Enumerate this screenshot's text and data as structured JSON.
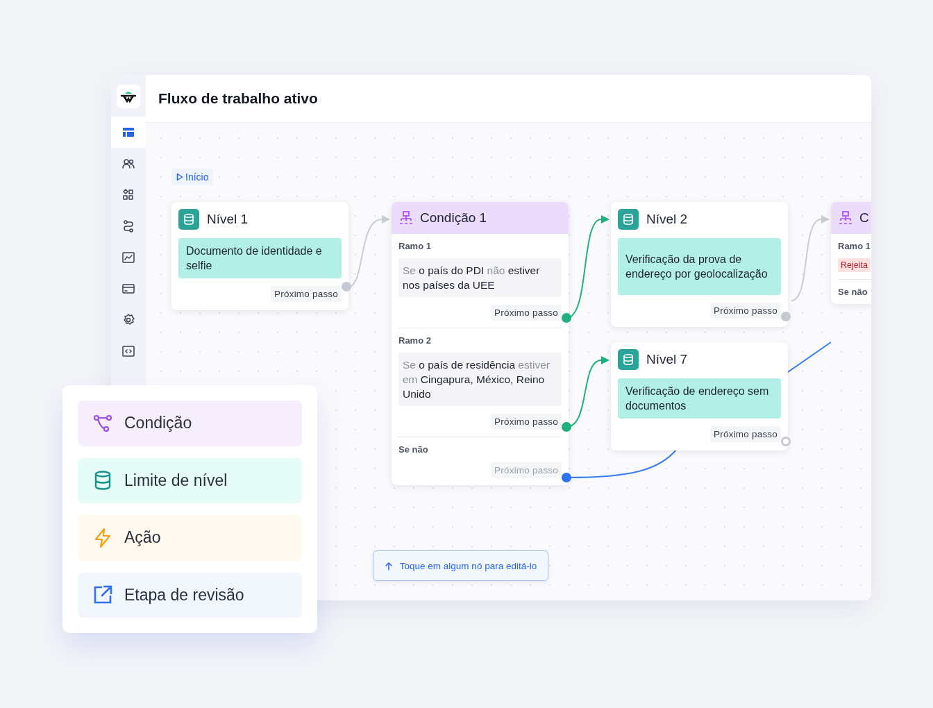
{
  "window": {
    "title": "Fluxo de trabalho ativo"
  },
  "sidebar": {
    "items": [
      {
        "selected": true
      },
      {
        "selected": false
      },
      {
        "selected": false
      },
      {
        "selected": false
      },
      {
        "selected": false
      },
      {
        "selected": false
      },
      {
        "selected": false
      },
      {
        "selected": false
      }
    ]
  },
  "start": {
    "label": "Início"
  },
  "nodes": [
    {
      "kind": "level",
      "title": "Nível 1",
      "description": "Documento de identidade e selfie",
      "next": "Próximo passo"
    },
    {
      "kind": "condition",
      "title": "Condição 1",
      "branches": [
        {
          "label": "Ramo 1",
          "condition": [
            {
              "text": "Se",
              "muted": true
            },
            {
              "text": "o país do PDI",
              "muted": false
            },
            {
              "text": "não",
              "muted": true
            },
            {
              "text": "estiver nos países da UEE",
              "muted": false
            }
          ],
          "next": "Próximo passo",
          "next_muted": false
        },
        {
          "label": "Ramo 2",
          "condition": [
            {
              "text": "Se",
              "muted": true
            },
            {
              "text": "o país de residência",
              "muted": false
            },
            {
              "text": "estiver em",
              "muted": true
            },
            {
              "text": "Cingapura, México, Reino Unido",
              "muted": false
            }
          ],
          "next": "Próximo passo",
          "next_muted": false
        },
        {
          "label": "Se não",
          "next": "Próximo passo",
          "next_muted": true
        }
      ]
    },
    {
      "kind": "level",
      "title": "Nível 2",
      "description": "Verificação da prova de endereço por geolocalização",
      "next": "Próximo passo"
    },
    {
      "kind": "level",
      "title": "Nível 7",
      "description": "Verificação de endereço sem documentos",
      "next": "Próximo passo"
    },
    {
      "kind": "condition",
      "title": "C",
      "branches": [
        {
          "label": "Ramo 1",
          "tag": "Rejeita"
        },
        {
          "label": "Se não"
        }
      ]
    }
  ],
  "hint": {
    "text": "Toque em algum nó para editá-lo"
  },
  "palette": [
    {
      "kind": "condition",
      "label": "Condição"
    },
    {
      "kind": "level",
      "label": "Limite de nível"
    },
    {
      "kind": "action",
      "label": "Ação"
    },
    {
      "kind": "review",
      "label": "Etapa de revisão"
    }
  ]
}
